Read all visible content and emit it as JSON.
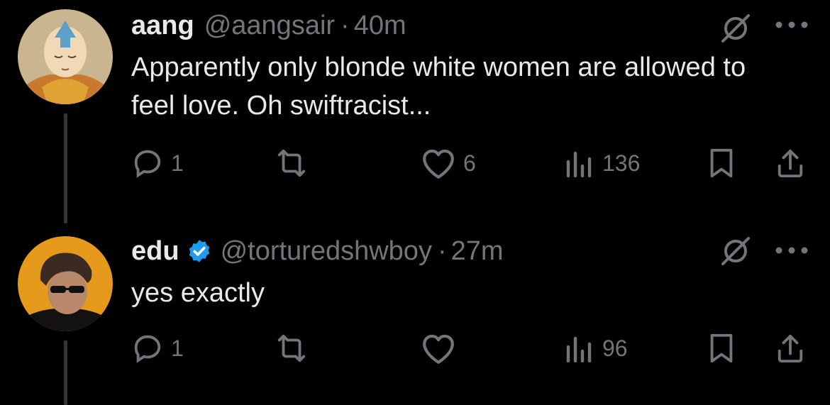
{
  "tweets": [
    {
      "name": "aang",
      "handle": "@aangsair",
      "separator": "·",
      "time": "40m",
      "text": "Apparently only blonde white women are allowed to feel love. Oh swiftracist...",
      "verified": false,
      "avatar_icon": "aang-avatar",
      "counts": {
        "replies": "1",
        "retweets": "",
        "likes": "6",
        "views": "136"
      }
    },
    {
      "name": "edu",
      "handle": "@torturedshwboy",
      "separator": "·",
      "time": "27m",
      "text": "yes exactly",
      "verified": true,
      "avatar_icon": "edu-avatar",
      "counts": {
        "replies": "1",
        "retweets": "",
        "likes": "",
        "views": "96"
      }
    }
  ],
  "colors": {
    "background": "#000000",
    "text_primary": "#e7e9ea",
    "text_secondary": "#71767b",
    "verified_blue": "#1d9bf0",
    "thread_line": "#333639"
  },
  "icons": [
    "reply-icon",
    "retweet-icon",
    "like-icon",
    "views-icon",
    "bookmark-icon",
    "share-icon",
    "grok-icon",
    "more-icon",
    "verified-badge-icon"
  ]
}
